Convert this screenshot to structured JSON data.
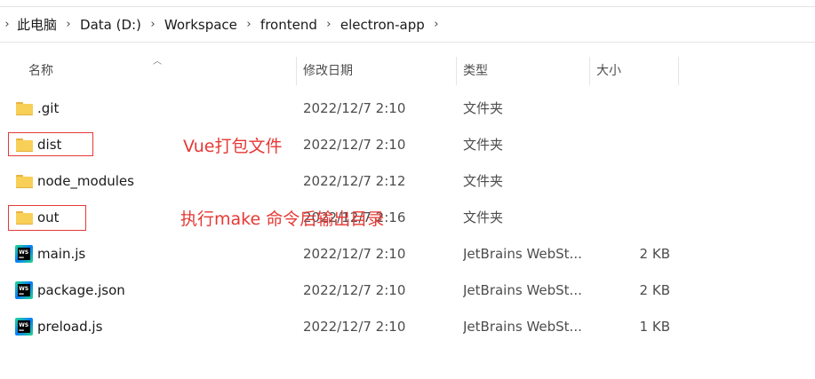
{
  "breadcrumb": {
    "items": [
      "此电脑",
      "Data (D:)",
      "Workspace",
      "frontend",
      "electron-app"
    ]
  },
  "columns": {
    "name": "名称",
    "date": "修改日期",
    "type": "类型",
    "size": "大小"
  },
  "files": [
    {
      "name": ".git",
      "date": "2022/12/7 2:10",
      "type": "文件夹",
      "size": "",
      "icon": "folder-icon"
    },
    {
      "name": "dist",
      "date": "2022/12/7 2:10",
      "type": "文件夹",
      "size": "",
      "icon": "folder-icon"
    },
    {
      "name": "node_modules",
      "date": "2022/12/7 2:12",
      "type": "文件夹",
      "size": "",
      "icon": "folder-icon"
    },
    {
      "name": "out",
      "date": "2022/12/7 2:16",
      "type": "文件夹",
      "size": "",
      "icon": "folder-icon"
    },
    {
      "name": "main.js",
      "date": "2022/12/7 2:10",
      "type": "JetBrains WebSt...",
      "size": "2 KB",
      "icon": "webstorm-icon"
    },
    {
      "name": "package.json",
      "date": "2022/12/7 2:10",
      "type": "JetBrains WebSt...",
      "size": "2 KB",
      "icon": "webstorm-icon"
    },
    {
      "name": "preload.js",
      "date": "2022/12/7 2:10",
      "type": "JetBrains WebSt...",
      "size": "1 KB",
      "icon": "webstorm-icon"
    }
  ],
  "annotations": {
    "dist_note": "Vue打包文件",
    "out_note": "执行make 命令后输出目录"
  },
  "colors": {
    "annotation": "#e53935",
    "folder": "#f8cf57"
  }
}
